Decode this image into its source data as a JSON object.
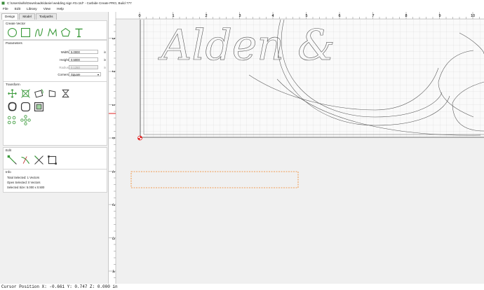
{
  "window": {
    "title": "C:\\Users\\wllo\\Downloads\\daniel wedding sign #3.c2d* - Carbide Create PRO, Build 777"
  },
  "menu": [
    "File",
    "Edit",
    "Library",
    "View",
    "Help"
  ],
  "tabs": [
    "Design",
    "Model",
    "Toolpaths"
  ],
  "panels": {
    "create_vector": {
      "title": "Create Vector",
      "icons": [
        "circle-icon",
        "rectangle-icon",
        "curve-icon",
        "polyline-icon",
        "polygon-icon",
        "text-icon"
      ]
    },
    "parameters": {
      "title": "Parameters",
      "width": {
        "label": "Width",
        "value": "5.0000",
        "unit": "in"
      },
      "height": {
        "label": "Height",
        "value": "0.5000",
        "unit": "in"
      },
      "radius": {
        "label": "Radius",
        "value": "0.1250",
        "unit": "in"
      },
      "corners": {
        "label": "Corners",
        "value": "Square"
      }
    },
    "transform": {
      "title": "Transform"
    },
    "edit": {
      "title": "Edit"
    },
    "info": {
      "title": "Info",
      "total_selected": "Total Selected:  1 Vectors",
      "open_selected": "Open Selected:  0 Vectors",
      "selected_size": "Selected Size:   5.000 x 0.500"
    }
  },
  "ruler": {
    "x_labels": [
      "0",
      "1",
      "2",
      "3",
      "4",
      "5",
      "6",
      "7",
      "8",
      "9",
      "10"
    ],
    "y_labels": [
      "3",
      "2",
      "1",
      "0",
      "-1",
      "-2",
      "-3",
      "-4"
    ]
  },
  "design_text": "Alden &",
  "colors": {
    "selection": "#f08020",
    "accent_green": "#4caf50",
    "origin": "#e02020"
  },
  "status": {
    "text": "Cursor Position X: -0.661 Y: 0.747 Z: 0.000 in"
  }
}
